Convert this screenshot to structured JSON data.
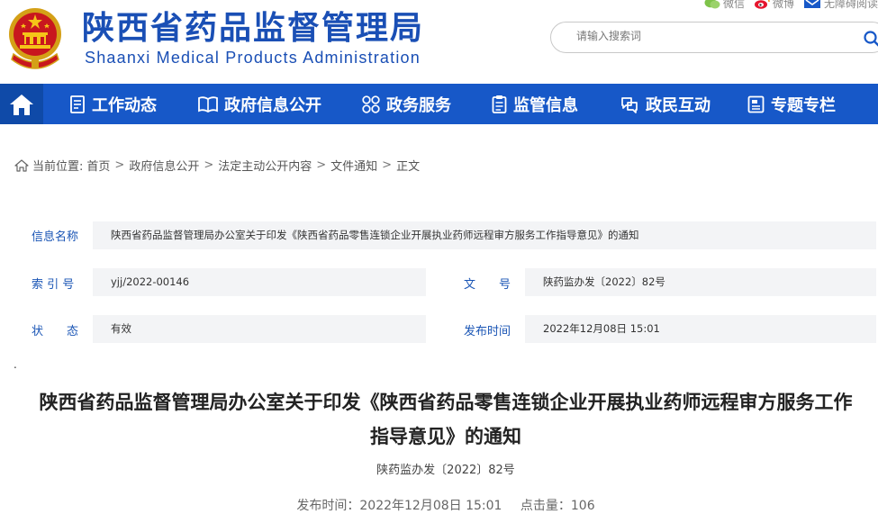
{
  "header": {
    "title": "陕西省药品监督管理局",
    "subtitle": "Shaanxi Medical Products Administration",
    "top_links": [
      {
        "label": "微信",
        "icon": "wechat-icon"
      },
      {
        "label": "微博",
        "icon": "weibo-icon"
      },
      {
        "label": "无障碍阅读",
        "icon": "accessibility-icon"
      }
    ],
    "search_placeholder": "请输入搜索词"
  },
  "nav": {
    "items": [
      {
        "label": "工作动态",
        "icon": "document-list-icon"
      },
      {
        "label": "政府信息公开",
        "icon": "book-icon"
      },
      {
        "label": "政务服务",
        "icon": "grid-icon"
      },
      {
        "label": "监管信息",
        "icon": "clipboard-icon"
      },
      {
        "label": "政民互动",
        "icon": "chat-icon"
      },
      {
        "label": "专题专栏",
        "icon": "folder-icon"
      }
    ]
  },
  "breadcrumb": {
    "prefix": "当前位置:",
    "items": [
      "首页",
      "政府信息公开",
      "法定主动公开内容",
      "文件通知",
      "正文"
    ]
  },
  "info": {
    "name_label": "信息名称",
    "name_value": "陕西省药品监督管理局办公室关于印发《陕西省药品零售连锁企业开展执业药师远程审方服务工作指导意见》的通知",
    "index_label": "索 引 号",
    "index_value": "yjj/2022-00146",
    "docno_label": "文　　号",
    "docno_value": "陕药监办发〔2022〕82号",
    "status_label": "状　　态",
    "status_value": "有效",
    "date_label": "发布时间",
    "date_value": "2022年12月08日 15:01"
  },
  "article": {
    "dot": ".",
    "title": "陕西省药品监督管理局办公室关于印发《陕西省药品零售连锁企业开展执业药师远程审方服务工作指导意见》的通知",
    "doc_no": "陕药监办发〔2022〕82号",
    "publish_label": "发布时间：",
    "publish_time": "2022年12月08日 15:01",
    "clicks_label": "点击量：",
    "clicks": "106"
  },
  "colors": {
    "brand_blue": "#1758c8",
    "title_blue": "#1a4fb5",
    "label_blue": "#1a55b5"
  }
}
